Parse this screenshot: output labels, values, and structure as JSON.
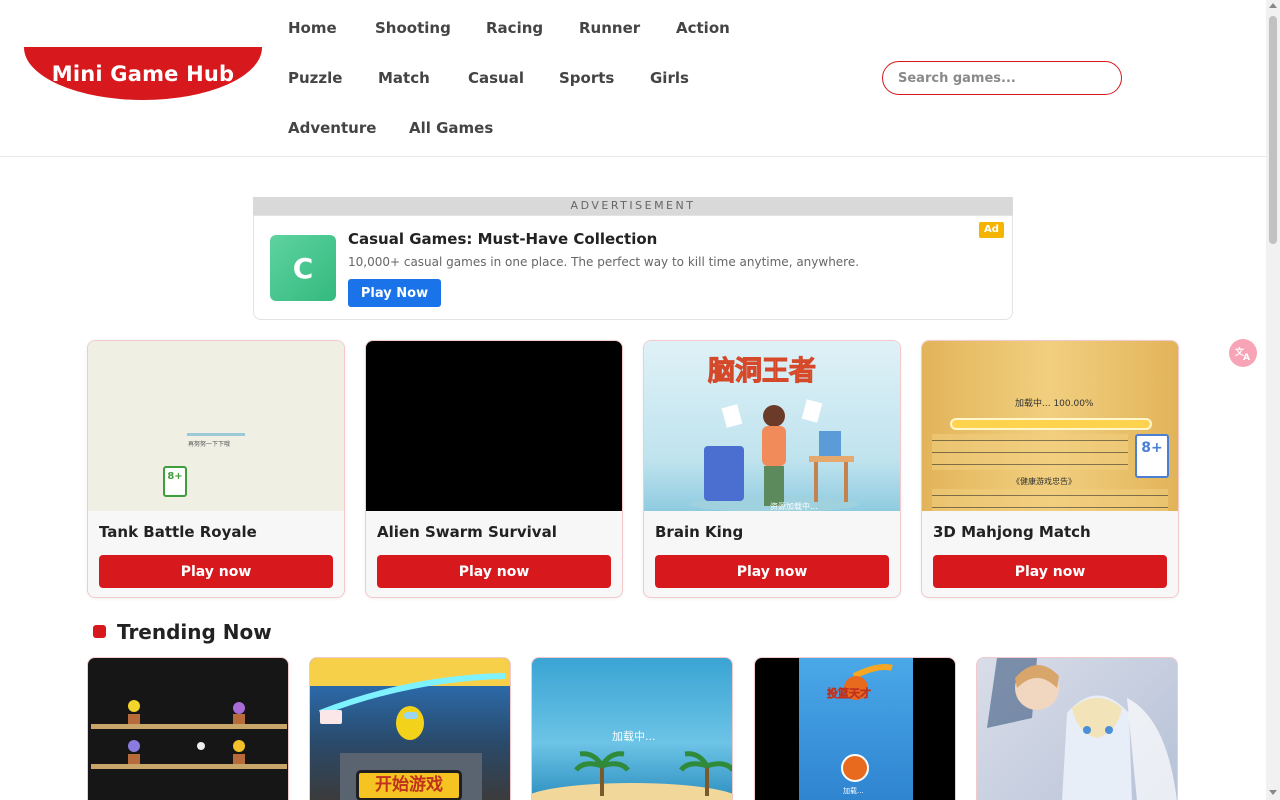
{
  "brand": {
    "name": "Mini Game Hub",
    "color": "#d7181c"
  },
  "nav": {
    "items": [
      "Home",
      "Shooting",
      "Racing",
      "Runner",
      "Action",
      "Puzzle",
      "Match",
      "Casual",
      "Sports",
      "Girls",
      "Adventure",
      "All Games"
    ]
  },
  "search": {
    "placeholder": "Search games..."
  },
  "ad": {
    "label": "ADVERTISEMENT",
    "icon_letter": "C",
    "title": "Casual Games: Must-Have Collection",
    "description": "10,000+ casual games in one place. The perfect way to kill time anytime, anywhere.",
    "button": "Play Now",
    "badge": "Ad",
    "button_color": "#1a73e8"
  },
  "featured": [
    {
      "title": "Tank Battle Royale",
      "button": "Play now",
      "thumb_text": "再努努一下下哦",
      "age": "8+"
    },
    {
      "title": "Alien Swarm Survival",
      "button": "Play now"
    },
    {
      "title": "Brain King",
      "button": "Play now",
      "thumb_text": "脑洞王者",
      "loading": "资源加载中..."
    },
    {
      "title": "3D Mahjong Match",
      "button": "Play now",
      "thumb_text": "加载中... 100.00%",
      "age": "8+",
      "notice": "《健康游戏忠告》"
    }
  ],
  "trending": {
    "title": "Trending Now",
    "thumb_texts": [
      "开始游戏",
      "加载中...",
      "投篮天才",
      "加载..."
    ]
  },
  "icons": {
    "translate": "translate-icon"
  }
}
